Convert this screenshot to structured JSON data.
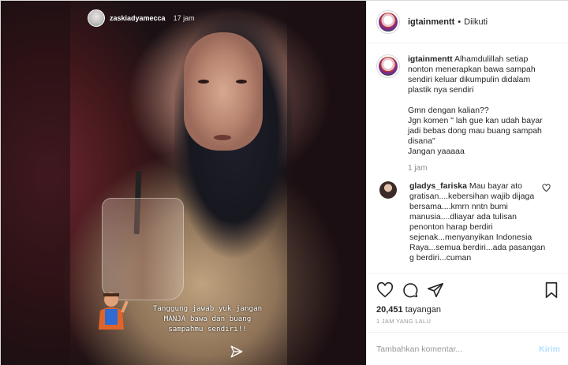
{
  "story": {
    "username": "zaskiadyamecca",
    "time": "17 jam",
    "caption": "Tanggung jawab yuk jangan\nMANJA bawa dan buang\nsampahmu sendiri!!"
  },
  "post": {
    "username": "igtainmentt",
    "dot": "•",
    "follow_status": "Diikuti",
    "caption_text": "Alhamdulillah setiap nonton menerapkan bawa sampah sendiri keluar dikumpulin didalam plastik nya sendiri\n\nGmn dengan kalian??\nJgn komen \" lah gue kan udah bayar jadi bebas dong mau buang sampah disana\"\nJangan yaaaaa",
    "caption_time": "1 jam"
  },
  "comments": [
    {
      "username": "gladys_fariska",
      "text": "Mau bayar ato gratisan....kebersihan wajib dijaga bersama....kmrn nntn bumi manusia....dliayar ada tulisan penonton harap berdiri sejenak...menyanyikan Indonesia Raya...semua berdiri...ada pasangan g berdiri...cuman"
    }
  ],
  "actions": {
    "views_count": "20,451",
    "views_label": "tayangan",
    "posted_ago": "1 JAM YANG LALU"
  },
  "add_comment": {
    "placeholder": "Tambahkan komentar...",
    "post_label": "Kirim"
  },
  "icons": {
    "like": "heart-icon",
    "comment": "comment-icon",
    "share": "share-icon",
    "save": "bookmark-icon",
    "send": "send-icon"
  }
}
